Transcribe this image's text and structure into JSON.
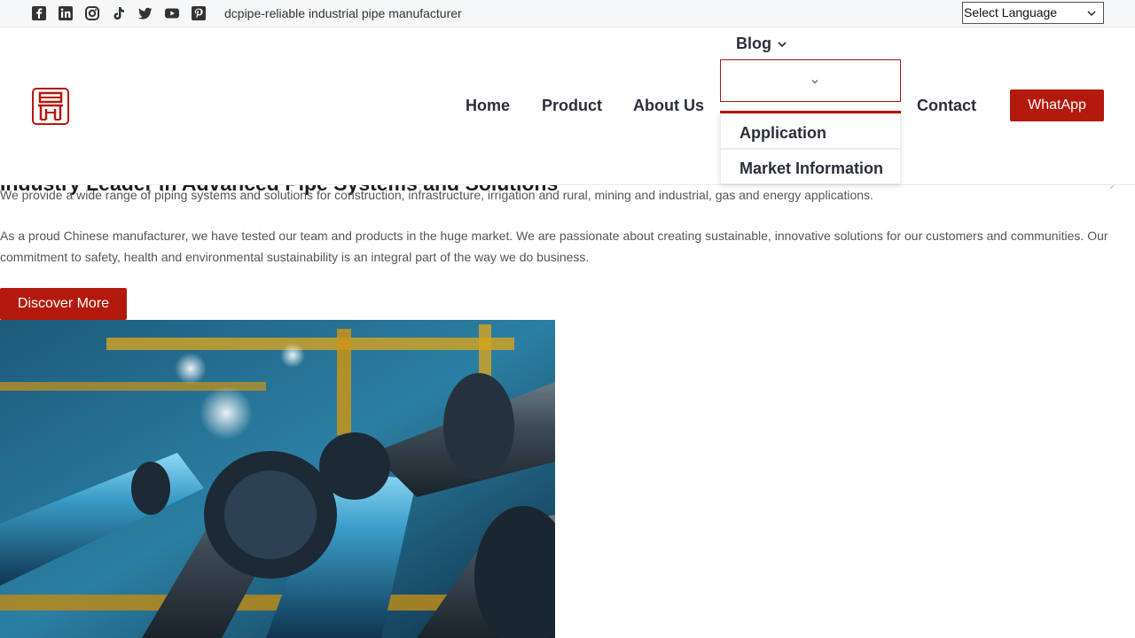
{
  "topbar": {
    "social": [
      {
        "name": "facebook-icon"
      },
      {
        "name": "linkedin-icon"
      },
      {
        "name": "instagram-icon"
      },
      {
        "name": "tiktok-icon"
      },
      {
        "name": "twitter-icon"
      },
      {
        "name": "youtube-icon"
      },
      {
        "name": "pinterest-icon"
      }
    ],
    "tagline": "dcpipe-reliable industrial pipe manufacturer",
    "language_select": "Select Language"
  },
  "header": {
    "nav": {
      "home": "Home",
      "product": "Product",
      "about": "About Us",
      "blog": "Blog",
      "contact": "Contact"
    },
    "whatsapp_label": "WhatApp",
    "blog_dropdown": [
      "Application",
      "Market Information"
    ]
  },
  "main": {
    "title": "Industry Leader in Advanced Pipe Systems and Solutions",
    "intro": "We provide a wide range of piping systems and solutions for construction, infrastructure, irrigation and rural, mining and industrial, gas and energy applications.",
    "paragraph": "As a proud Chinese manufacturer, we have tested our team and products in the huge market. We are passionate about creating sustainable, innovative solutions for our customers and communities. Our commitment to safety, health and environmental sustainability is an integral part of the way we do business.",
    "discover_label": "Discover More"
  },
  "colors": {
    "accent": "#b3190c",
    "nav_text": "#2b2f3a"
  }
}
